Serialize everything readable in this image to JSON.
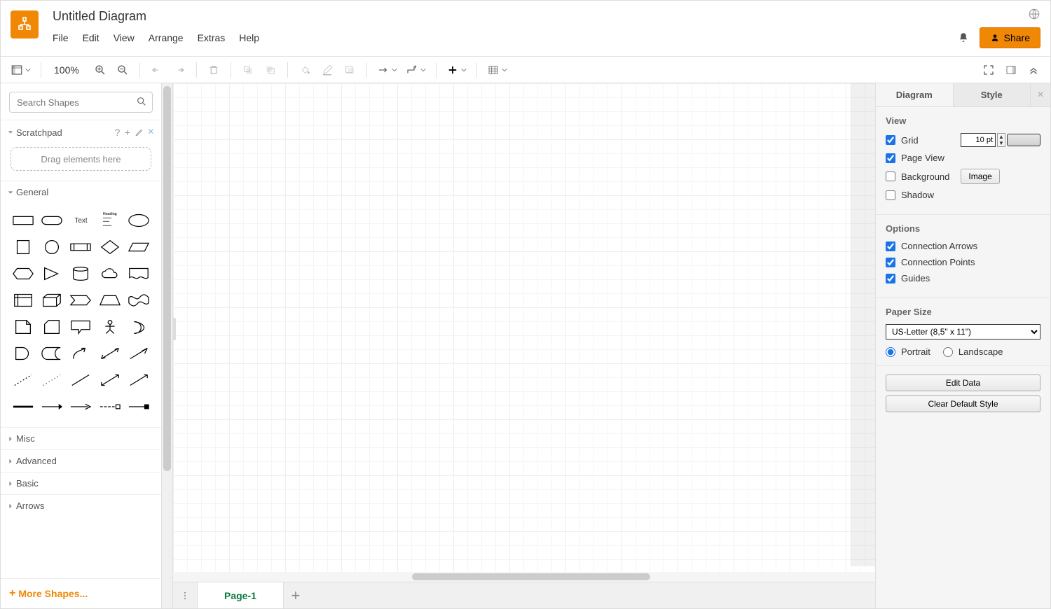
{
  "header": {
    "title": "Untitled Diagram",
    "menus": [
      "File",
      "Edit",
      "View",
      "Arrange",
      "Extras",
      "Help"
    ],
    "share_label": "Share"
  },
  "toolbar": {
    "zoom": "100%"
  },
  "sidebar": {
    "search_placeholder": "Search Shapes",
    "scratchpad_label": "Scratchpad",
    "scratchpad_drop": "Drag elements here",
    "sections": {
      "general": "General",
      "misc": "Misc",
      "advanced": "Advanced",
      "basic": "Basic",
      "arrows": "Arrows"
    },
    "shapes_general": [
      "rectangle",
      "rounded-rectangle",
      "text",
      "heading",
      "ellipse",
      "square",
      "circle",
      "process",
      "diamond",
      "parallelogram",
      "hexagon",
      "triangle",
      "cylinder",
      "cloud",
      "document",
      "internal-storage",
      "cube",
      "step",
      "trapezoid",
      "tape",
      "note",
      "card",
      "callout",
      "actor",
      "or-gate",
      "and-gate",
      "data-storage",
      "curved-arrow",
      "bidirectional-arrow",
      "arrow",
      "dashed-line-1",
      "dashed-line-2",
      "line",
      "bidirectional-line",
      "arrow-line",
      "thick-line",
      "connector-1",
      "connector-2",
      "connector-3",
      "connector-4"
    ],
    "text_label": "Text",
    "heading_label": "Heading",
    "more_shapes": "More Shapes..."
  },
  "pages": {
    "tabs": [
      "Page-1"
    ]
  },
  "right_panel": {
    "tabs": {
      "diagram": "Diagram",
      "style": "Style"
    },
    "view": {
      "title": "View",
      "grid_label": "Grid",
      "grid_checked": true,
      "grid_size": "10 pt",
      "page_view_label": "Page View",
      "page_view_checked": true,
      "background_label": "Background",
      "background_checked": false,
      "image_btn": "Image",
      "shadow_label": "Shadow",
      "shadow_checked": false
    },
    "options": {
      "title": "Options",
      "connection_arrows": "Connection Arrows",
      "connection_arrows_checked": true,
      "connection_points": "Connection Points",
      "connection_points_checked": true,
      "guides": "Guides",
      "guides_checked": true
    },
    "paper": {
      "title": "Paper Size",
      "selected": "US-Letter (8,5\" x 11\")",
      "portrait": "Portrait",
      "landscape": "Landscape",
      "orientation": "portrait"
    },
    "actions": {
      "edit_data": "Edit Data",
      "clear_style": "Clear Default Style"
    }
  }
}
